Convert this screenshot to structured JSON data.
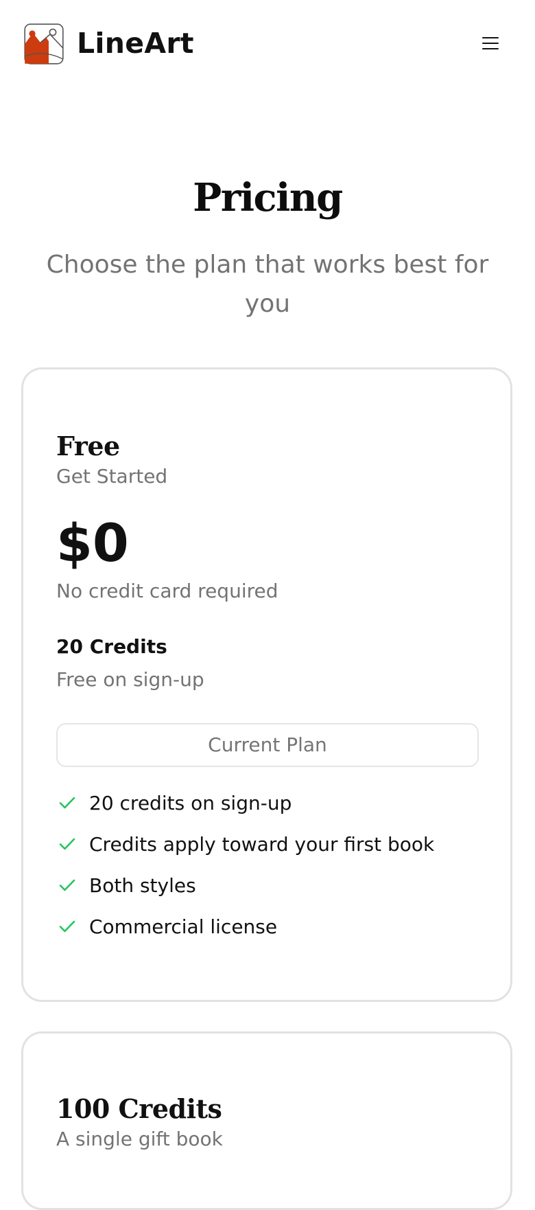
{
  "header": {
    "brand": "LineArt",
    "logo_icon": "picture-frame-icon",
    "menu_icon": "hamburger-menu-icon",
    "colors": {
      "logo_accent": "#cc3c0f"
    }
  },
  "hero": {
    "title": "Pricing",
    "subtitle": "Choose the plan that works best for you"
  },
  "plans": [
    {
      "name": "Free",
      "tagline": "Get Started",
      "price": "$0",
      "price_note": "No credit card required",
      "credits_title": "20 Credits",
      "credits_note": "Free on sign-up",
      "button_label": "Current Plan",
      "features": [
        "20 credits on sign-up",
        "Credits apply toward your first book",
        "Both styles",
        "Commercial license"
      ],
      "feature_icon": "check-icon",
      "colors": {
        "check": "#22c55e"
      }
    },
    {
      "name": "100 Credits",
      "tagline": "A single gift book"
    }
  ]
}
